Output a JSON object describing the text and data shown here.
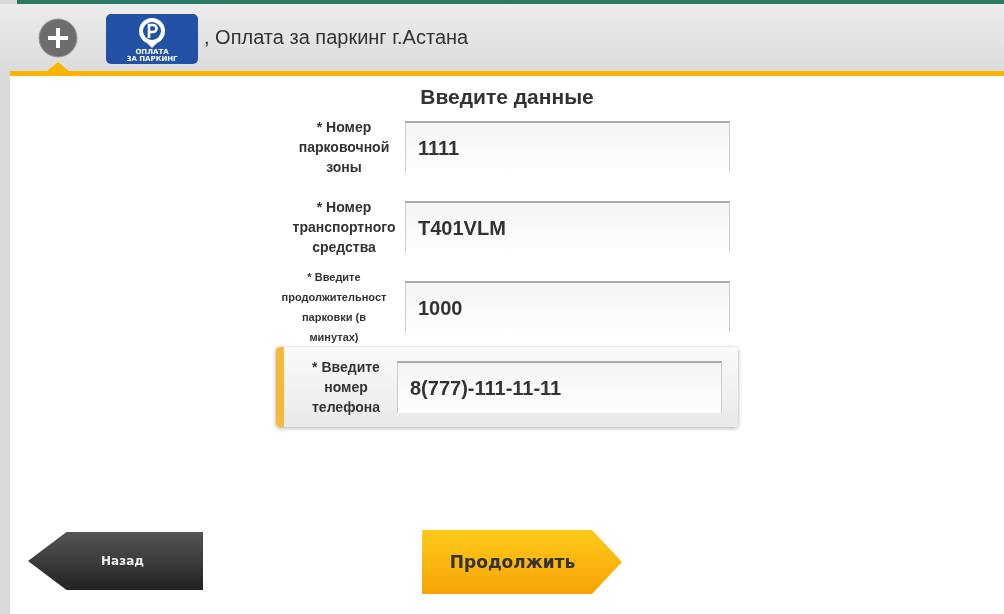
{
  "header": {
    "logo_lines": [
      "ОПЛАТА",
      "ЗА ПАРКИНГ"
    ],
    "title": ", Оплата за паркинг г.Астана"
  },
  "form": {
    "title": "Введите данные",
    "fields": [
      {
        "label": "* Номер парковочной зоны",
        "value": "1111",
        "kind": "normal",
        "selected": false
      },
      {
        "label": "* Номер транспортного средства",
        "value": "T401VLM",
        "kind": "normal",
        "selected": false
      },
      {
        "label": "* Введите продолжительност парковки (в минутах)",
        "value": "1000",
        "kind": "compact",
        "selected": false
      },
      {
        "label": "* Введите номер телефона",
        "value": "8(777)-111-11-11",
        "kind": "normal",
        "selected": true
      }
    ]
  },
  "buttons": {
    "back": "Назад",
    "next": "Продолжить"
  }
}
